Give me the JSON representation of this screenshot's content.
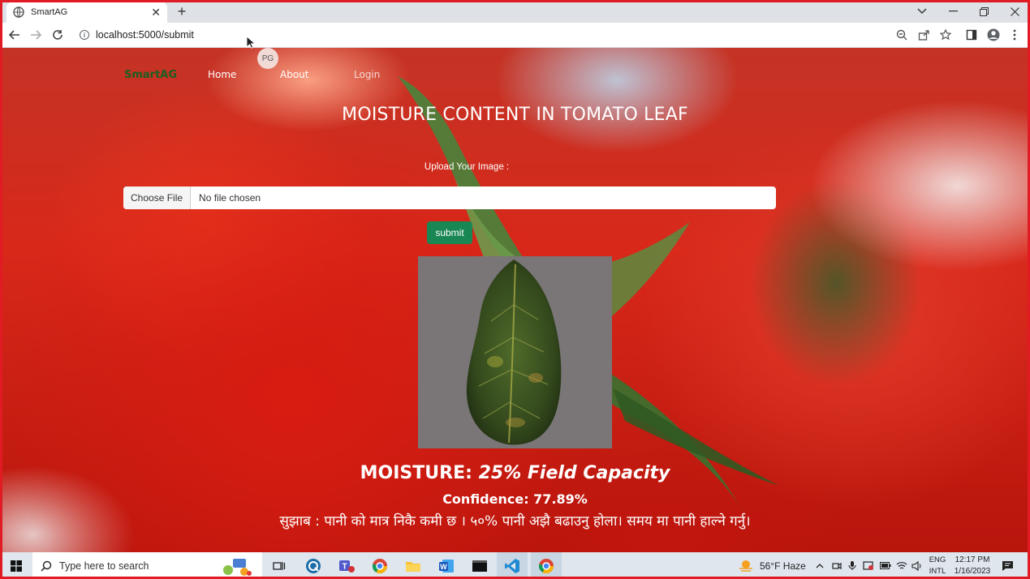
{
  "browser": {
    "tab_title": "SmartAG",
    "url": "localhost:5000/submit",
    "new_tab_label": "+"
  },
  "site": {
    "brand": "SmartAG",
    "nav": [
      "Home",
      "About",
      "Login"
    ],
    "profile_initials": "PG",
    "heading": "MOISTURE CONTENT IN TOMATO LEAF",
    "upload_label": "Upload Your Image :",
    "choose_file": "Choose File",
    "no_file": "No file chosen",
    "submit": "submit",
    "result_label": "MOISTURE:",
    "result_value": "25% Field Capacity",
    "confidence": "Confidence: 77.89%",
    "suggestion": "सुझाब : पानी को मात्र निकै कमी छ । ५०% पानी अझै बढाउनु होला। समय मा पानी हाल्ने गर्नु।"
  },
  "taskbar": {
    "search_placeholder": "Type here to search",
    "weather": "56°F  Haze",
    "lang_line1": "ENG",
    "lang_line2": "INTL",
    "time": "12:17 PM",
    "date": "1/16/2023"
  },
  "colors": {
    "frame": "#e01b24",
    "brand": "#1b5e20",
    "submit": "#198754"
  }
}
